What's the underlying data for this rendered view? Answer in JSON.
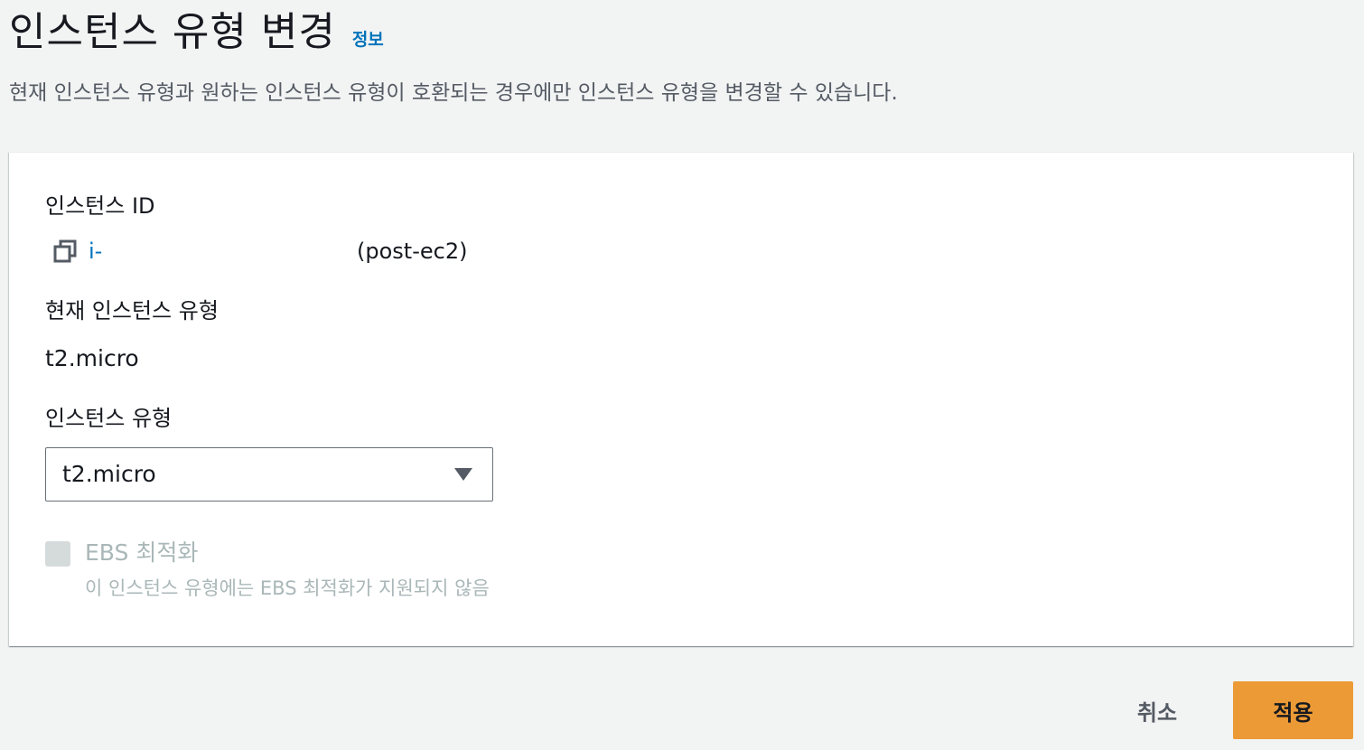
{
  "header": {
    "title": "인스턴스 유형 변경",
    "info_link": "정보",
    "description": "현재 인스턴스 유형과 원하는 인스턴스 유형이 호환되는 경우에만 인스턴스 유형을 변경할 수 있습니다."
  },
  "form": {
    "instance_id_label": "인스턴스 ID",
    "instance_id_value": "i-",
    "instance_name": "(post-ec2)",
    "current_type_label": "현재 인스턴스 유형",
    "current_type_value": "t2.micro",
    "type_label": "인스턴스 유형",
    "type_select_value": "t2.micro",
    "ebs_label": "EBS 최적화",
    "ebs_description": "이 인스턴스 유형에는 EBS 최적화가 지원되지 않음"
  },
  "actions": {
    "cancel_label": "취소",
    "apply_label": "적용"
  },
  "colors": {
    "link": "#0073bb",
    "primary_button": "#ec9a36",
    "disabled_text": "#aab7b8",
    "page_background": "#f2f3f3"
  },
  "icons": {
    "copy": "copy-icon",
    "dropdown": "caret-down-icon"
  }
}
